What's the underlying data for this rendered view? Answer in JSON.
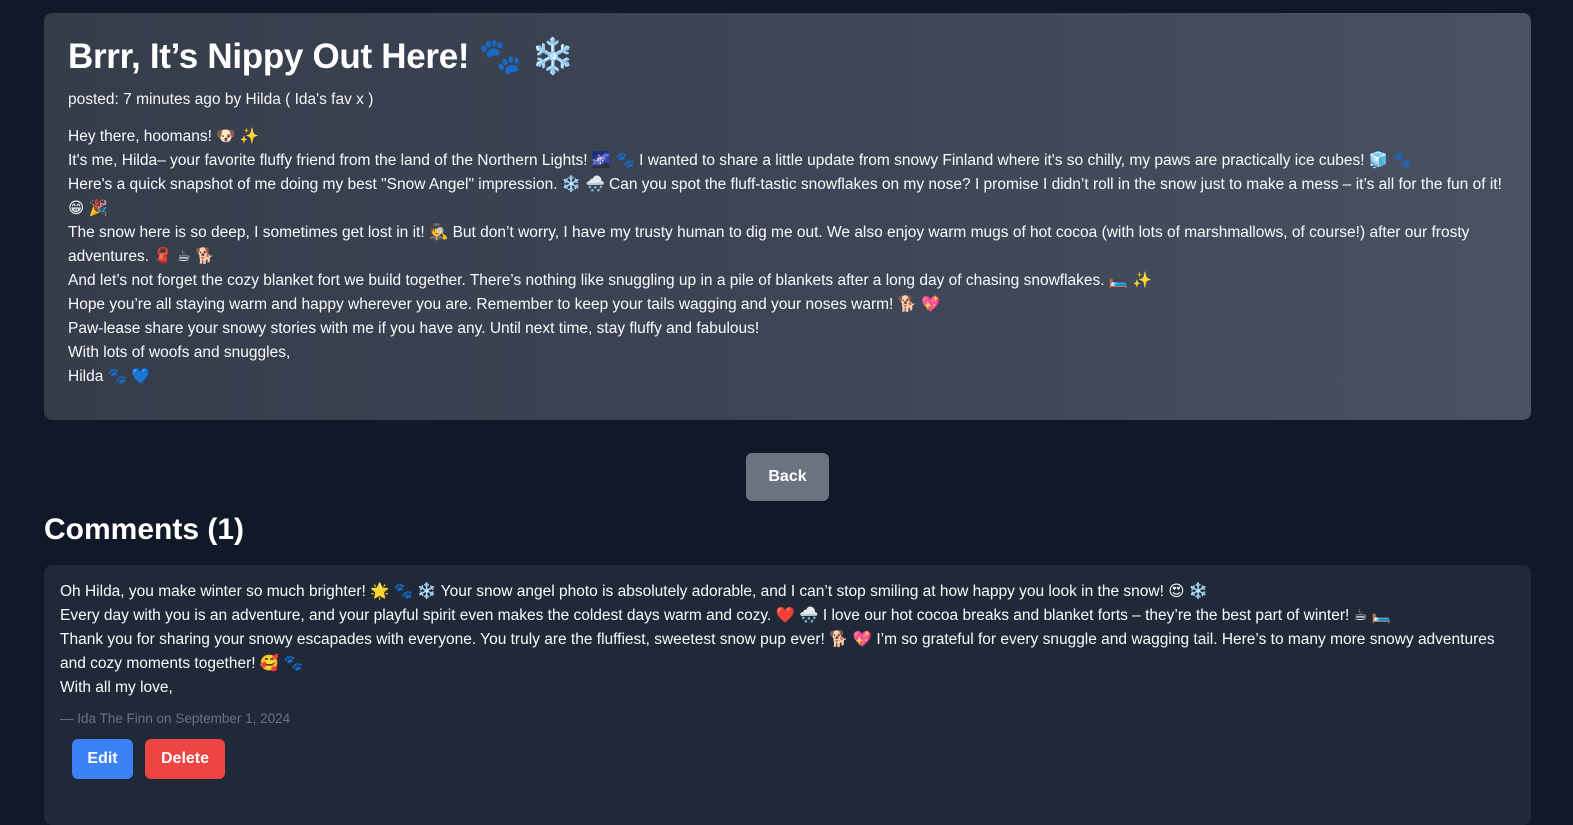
{
  "post": {
    "title": "Brrr, It’s Nippy Out Here! 🐾 ❄️",
    "meta": "posted: 7 minutes ago by Hilda ( Ida's fav x )",
    "paragraphs": [
      "Hey there, hoomans! 🐶 ✨",
      "It's me, Hilda– your favorite fluffy friend from the land of the Northern Lights! 🌌 🐾 I wanted to share a little update from snowy Finland where it's so chilly, my paws are practically ice cubes! 🧊 🐾",
      "Here's a quick snapshot of me doing my best \"Snow Angel\" impression. ❄️ 🌨️ Can you spot the fluff-tastic snowflakes on my nose? I promise I didn’t roll in the snow just to make a mess – it’s all for the fun of it! 😁 🎉",
      "The snow here is so deep, I sometimes get lost in it! 🕵️ But don’t worry, I have my trusty human to dig me out. We also enjoy warm mugs of hot cocoa (with lots of marshmallows, of course!) after our frosty adventures. 🧣 ☕ 🐕",
      "And let’s not forget the cozy blanket fort we build together. There’s nothing like snuggling up in a pile of blankets after a long day of chasing snowflakes. 🛏️ ✨",
      "Hope you’re all staying warm and happy wherever you are. Remember to keep your tails wagging and your noses warm! 🐕 💖",
      "Paw-lease share your snowy stories with me if you have any. Until next time, stay fluffy and fabulous!",
      "With lots of woofs and snuggles,",
      "Hilda 🐾 💙"
    ]
  },
  "back_label": "Back",
  "comments_heading": "Comments (1)",
  "comment": {
    "paragraphs": [
      "Oh Hilda, you make winter so much brighter! 🌟 🐾 ❄️ Your snow angel photo is absolutely adorable, and I can’t stop smiling at how happy you look in the snow! 😍 ❄️",
      "Every day with you is an adventure, and your playful spirit even makes the coldest days warm and cozy. ❤️ 🌨️ I love our hot cocoa breaks and blanket forts – they’re the best part of winter! ☕ 🛏️",
      "Thank you for sharing your snowy escapades with everyone. You truly are the fluffiest, sweetest snow pup ever! 🐕 💖 I’m so grateful for every snuggle and wagging tail. Here’s to many more snowy adventures and cozy moments together! 🥰 🐾",
      "With all my love,"
    ],
    "meta": "— Ida The Finn on September 1, 2024",
    "edit_label": "Edit",
    "delete_label": "Delete"
  },
  "colors": {
    "background": "#111827",
    "comment_card": "#1f2937",
    "edit_button": "#3b82f6",
    "delete_button": "#ef4444",
    "back_button": "#6b7280"
  }
}
